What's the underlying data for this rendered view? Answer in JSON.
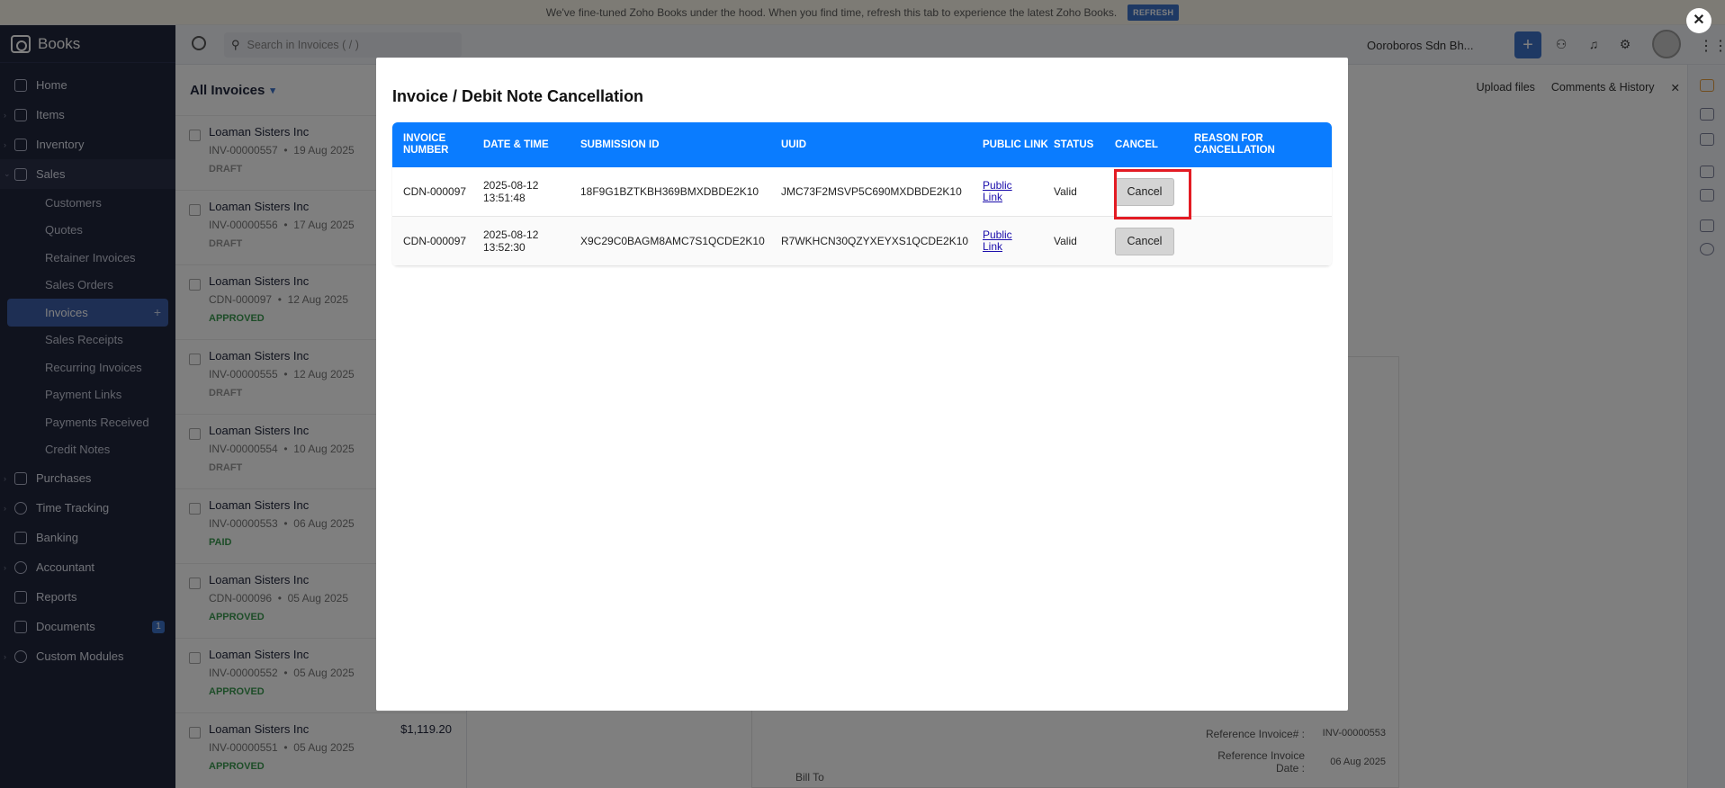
{
  "banner": {
    "text": "We've fine-tuned Zoho Books under the hood. When you find time, refresh this tab to experience the latest Zoho Books.",
    "refresh_label": "REFRESH"
  },
  "app": {
    "name": "Books"
  },
  "sidebar": {
    "items": [
      {
        "label": "Home",
        "icon": "home-icon"
      },
      {
        "label": "Items",
        "icon": "tag-icon"
      },
      {
        "label": "Inventory",
        "icon": "box-icon"
      },
      {
        "label": "Sales",
        "icon": "cart-icon"
      }
    ],
    "sales_sub": [
      {
        "label": "Customers"
      },
      {
        "label": "Quotes"
      },
      {
        "label": "Retainer Invoices"
      },
      {
        "label": "Sales Orders"
      },
      {
        "label": "Invoices"
      },
      {
        "label": "Sales Receipts"
      },
      {
        "label": "Recurring Invoices"
      },
      {
        "label": "Payment Links"
      },
      {
        "label": "Payments Received"
      },
      {
        "label": "Credit Notes"
      }
    ],
    "bottom_items": [
      {
        "label": "Purchases"
      },
      {
        "label": "Time Tracking"
      },
      {
        "label": "Banking"
      },
      {
        "label": "Accountant"
      },
      {
        "label": "Reports"
      },
      {
        "label": "Documents",
        "badge": "1"
      },
      {
        "label": "Custom Modules"
      }
    ]
  },
  "topbar": {
    "search_placeholder": "Search in Invoices ( / )",
    "org_name": "Ooroboros Sdn Bh..."
  },
  "list": {
    "title": "All Invoices",
    "rows": [
      {
        "customer": "Loaman Sisters Inc",
        "number": "INV-00000557",
        "date": "19 Aug 2025",
        "status": "DRAFT",
        "amount": ""
      },
      {
        "customer": "Loaman Sisters Inc",
        "number": "INV-00000556",
        "date": "17 Aug 2025",
        "status": "DRAFT",
        "amount": ""
      },
      {
        "customer": "Loaman Sisters Inc",
        "number": "CDN-000097",
        "date": "12 Aug 2025",
        "status": "APPROVED",
        "amount": ""
      },
      {
        "customer": "Loaman Sisters Inc",
        "number": "INV-00000555",
        "date": "12 Aug 2025",
        "status": "DRAFT",
        "amount": ""
      },
      {
        "customer": "Loaman Sisters Inc",
        "number": "INV-00000554",
        "date": "10 Aug 2025",
        "status": "DRAFT",
        "amount": ""
      },
      {
        "customer": "Loaman Sisters Inc",
        "number": "INV-00000553",
        "date": "06 Aug 2025",
        "status": "PAID",
        "amount": ""
      },
      {
        "customer": "Loaman Sisters Inc",
        "number": "CDN-000096",
        "date": "05 Aug 2025",
        "status": "APPROVED",
        "amount": ""
      },
      {
        "customer": "Loaman Sisters Inc",
        "number": "INV-00000552",
        "date": "05 Aug 2025",
        "status": "APPROVED",
        "amount": ""
      },
      {
        "customer": "Loaman Sisters Inc",
        "number": "INV-00000551",
        "date": "05 Aug 2025",
        "status": "APPROVED",
        "amount": "$1,119.20"
      }
    ]
  },
  "detail": {
    "upload_label": "Upload files",
    "comments_label": "Comments & History",
    "ref_invoice_label": "Reference Invoice# :",
    "ref_invoice_value": "INV-00000553",
    "ref_date_label": "Reference Invoice Date :",
    "ref_date_value": "06 Aug 2025",
    "bill_to": "Bill To"
  },
  "modal": {
    "title": "Invoice / Debit Note Cancellation",
    "headers": [
      "INVOICE NUMBER",
      "DATE & TIME",
      "SUBMISSION ID",
      "UUID",
      "PUBLIC LINK",
      "STATUS",
      "CANCEL",
      "REASON FOR CANCELLATION"
    ],
    "rows": [
      {
        "invoice_number": "CDN-000097",
        "datetime": "2025-08-12 13:51:48",
        "submission_id": "18F9G1BZTKBH369BMXDBDE2K10",
        "uuid": "JMC73F2MSVP5C690MXDBDE2K10",
        "public_link": "Public Link",
        "status": "Valid",
        "cancel_label": "Cancel",
        "reason": ""
      },
      {
        "invoice_number": "CDN-000097",
        "datetime": "2025-08-12 13:52:30",
        "submission_id": "X9C29C0BAGM8AMC7S1QCDE2K10",
        "uuid": "R7WKHCN30QZYXEYXS1QCDE2K10",
        "public_link": "Public Link",
        "status": "Valid",
        "cancel_label": "Cancel",
        "reason": ""
      }
    ]
  },
  "colors": {
    "accent": "#0a7cff",
    "sidebar": "#21263c",
    "highlight": "#e31b23"
  }
}
